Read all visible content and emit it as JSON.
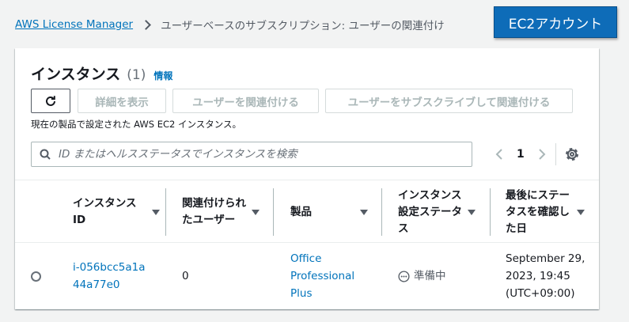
{
  "breadcrumb": {
    "root": "AWS License Manager",
    "current": "ユーザーベースのサブスクリプション: ユーザーの関連付け"
  },
  "callout": "EC2アカウント",
  "panel": {
    "title": "インスタンス",
    "count": "(1)",
    "info": "情報",
    "buttons": {
      "view_details": "詳細を表示",
      "associate": "ユーザーを関連付ける",
      "subscribe_associate": "ユーザーをサブスクライブして関連付ける"
    },
    "description": "現在の製品で設定された AWS EC2 インスタンス。",
    "search_placeholder": "ID またはヘルスステータスでインスタンスを検索",
    "page": "1"
  },
  "table": {
    "headers": {
      "instance_id": "インスタンス ID",
      "associated_users": "関連付けられたユーザー",
      "product": "製品",
      "instance_status": "インスタンス設定ステータス",
      "last_checked": "最後にステータスを確認した日"
    },
    "rows": [
      {
        "instance_id": "i-056bcc5a1a44a77e0",
        "associated_users": "0",
        "product": "Office Professional Plus",
        "status": "準備中",
        "last_checked": "September 29, 2023, 19:45 (UTC+09:00)"
      }
    ]
  },
  "colors": {
    "link": "#0073bb",
    "callout_bg": "#0e6cb8",
    "disabled_text": "#aab7b8"
  },
  "icons": {
    "refresh": "refresh-icon",
    "search": "search-icon",
    "settings": "gear-icon",
    "status": "pending-dots-icon"
  }
}
